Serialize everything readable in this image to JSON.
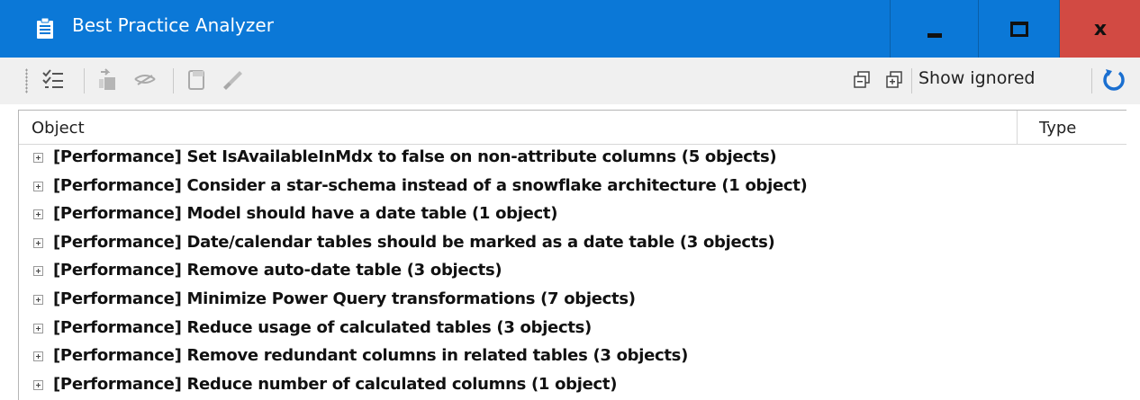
{
  "window": {
    "title": "Best Practice Analyzer",
    "controls": {
      "minimize": "minimize",
      "maximize": "maximize",
      "close": "x"
    }
  },
  "toolbar": {
    "show_ignored_label": "Show ignored",
    "icons": [
      "checklist-icon",
      "go-to-object-icon",
      "ignore-icon",
      "generate-fix-script-icon",
      "apply-fix-icon",
      "collapse-all-icon",
      "expand-all-icon",
      "refresh-icon"
    ]
  },
  "list": {
    "columns": [
      "Object",
      "Type"
    ],
    "rows": [
      {
        "text": "[Performance] Set IsAvailableInMdx to false on non-attribute columns (5 objects)"
      },
      {
        "text": "[Performance] Consider a star-schema instead of a snowflake architecture (1 object)"
      },
      {
        "text": "[Performance] Model should have a date table (1 object)"
      },
      {
        "text": "[Performance] Date/calendar tables should be marked as a date table (3 objects)"
      },
      {
        "text": "[Performance] Remove auto-date table (3 objects)"
      },
      {
        "text": "[Performance] Minimize Power Query transformations (7 objects)"
      },
      {
        "text": "[Performance] Reduce usage of calculated tables (3 objects)"
      },
      {
        "text": "[Performance] Remove redundant columns in related tables (3 objects)"
      },
      {
        "text": "[Performance] Reduce number of calculated columns (1 object)"
      }
    ]
  },
  "colors": {
    "titlebar": "#0b78d7",
    "close_button": "#d24a43",
    "toolbar": "#f0f0f0",
    "refresh_icon": "#1a6fd0"
  }
}
